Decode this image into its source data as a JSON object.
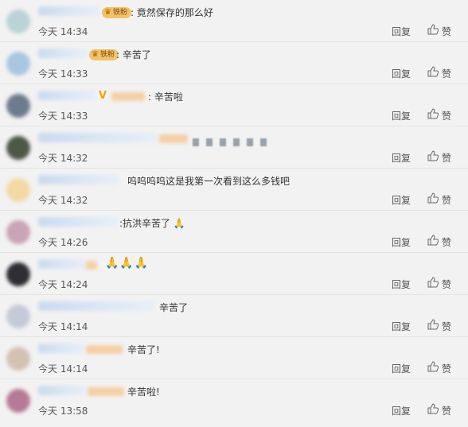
{
  "comments": [
    {
      "text": "竟然保存的那么好",
      "time": "今天 14:34",
      "badge": "铁粉"
    },
    {
      "text": "辛苦了",
      "time": "今天 14:33",
      "badge": "铁粉"
    },
    {
      "text": "辛苦啦",
      "time": "今天 14:33",
      "badge": ""
    },
    {
      "text": "",
      "time": "今天 14:32",
      "badge": ""
    },
    {
      "text": "呜呜呜呜这是我第一次看到这么多钱吧",
      "time": "今天 14:32",
      "badge": ""
    },
    {
      "text": ":抗洪辛苦了",
      "time": "今天 14:26",
      "badge": ""
    },
    {
      "text": "",
      "time": "今天 14:24",
      "badge": ""
    },
    {
      "text": "辛苦了",
      "time": "今天 14:14",
      "badge": ""
    },
    {
      "text": "辛苦了!",
      "time": "今天 14:14",
      "badge": ""
    },
    {
      "text": "辛苦啦!",
      "time": "今天 13:58",
      "badge": ""
    }
  ],
  "actions": {
    "reply": "回复",
    "like": "赞"
  },
  "icons": {
    "like": "thumbs-up-icon",
    "badge": "crown-icon",
    "verified": "v-badge-icon",
    "praise": "folded-hands-icon"
  },
  "colors": {
    "background": "#f2f2f2",
    "badge": "#f3c16a",
    "verified": "#f0a500",
    "name_blur": "#c9dbef"
  }
}
